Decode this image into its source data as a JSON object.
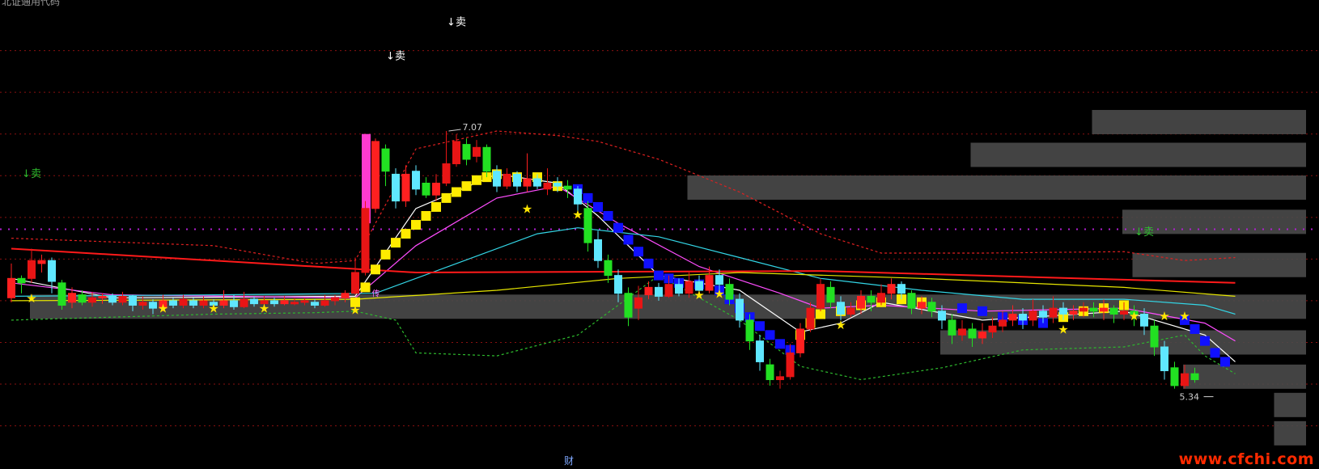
{
  "chart_data": {
    "type": "candlestick",
    "y_range": [
      4.8,
      7.95
    ],
    "grid_levels": [
      7.61,
      7.33,
      7.05,
      6.77,
      6.49,
      6.21,
      5.93,
      5.65,
      5.37,
      5.09
    ],
    "high_price": 7.07,
    "low_price": 5.34,
    "candles": [
      [
        5.95,
        6.08,
        6.18,
        5.92
      ],
      [
        6.08,
        6.05,
        6.1,
        5.98
      ],
      [
        6.08,
        6.2,
        6.28,
        6.05
      ],
      [
        6.18,
        6.2,
        6.24,
        6.12
      ],
      [
        6.2,
        6.06,
        6.22,
        5.98
      ],
      [
        6.05,
        5.9,
        6.07,
        5.87
      ],
      [
        5.92,
        5.98,
        6.02,
        5.88
      ],
      [
        5.97,
        5.92,
        6.0,
        5.9
      ],
      [
        5.92,
        5.95,
        5.99,
        5.89
      ],
      [
        5.95,
        5.96,
        5.98,
        5.91
      ],
      [
        5.96,
        5.92,
        5.98,
        5.9
      ],
      [
        5.92,
        5.96,
        5.99,
        5.9
      ],
      [
        5.96,
        5.9,
        5.97,
        5.86
      ],
      [
        5.9,
        5.92,
        5.96,
        5.87
      ],
      [
        5.92,
        5.88,
        5.94,
        5.84
      ],
      [
        5.88,
        5.93,
        5.97,
        5.86
      ],
      [
        5.93,
        5.9,
        5.95,
        5.88
      ],
      [
        5.9,
        5.94,
        5.97,
        5.88
      ],
      [
        5.93,
        5.9,
        5.95,
        5.88
      ],
      [
        5.9,
        5.93,
        5.96,
        5.88
      ],
      [
        5.92,
        5.9,
        5.94,
        5.87
      ],
      [
        5.9,
        5.93,
        6.0,
        5.88
      ],
      [
        5.93,
        5.89,
        5.97,
        5.87
      ],
      [
        5.89,
        5.94,
        5.99,
        5.88
      ],
      [
        5.94,
        5.91,
        5.96,
        5.89
      ],
      [
        5.91,
        5.93,
        5.96,
        5.9
      ],
      [
        5.93,
        5.91,
        5.95,
        5.89
      ],
      [
        5.91,
        5.93,
        5.96,
        5.9
      ],
      [
        5.92,
        5.92,
        5.95,
        5.9
      ],
      [
        5.92,
        5.93,
        5.95,
        5.9
      ],
      [
        5.92,
        5.9,
        5.94,
        5.88
      ],
      [
        5.9,
        5.93,
        5.97,
        5.89
      ],
      [
        5.93,
        5.95,
        5.97,
        5.9
      ],
      [
        5.95,
        5.98,
        6.0,
        5.92
      ],
      [
        5.98,
        6.12,
        6.22,
        5.97
      ],
      [
        6.12,
        6.55,
        6.6,
        6.1
      ],
      [
        6.55,
        7.0,
        7.02,
        6.52
      ],
      [
        6.95,
        6.8,
        6.98,
        6.7
      ],
      [
        6.78,
        6.6,
        6.82,
        6.55
      ],
      [
        6.6,
        6.78,
        6.84,
        6.56
      ],
      [
        6.8,
        6.68,
        6.84,
        6.64
      ],
      [
        6.72,
        6.64,
        6.76,
        6.62
      ],
      [
        6.64,
        6.72,
        6.78,
        6.6
      ],
      [
        6.72,
        6.85,
        7.07,
        6.7
      ],
      [
        6.85,
        7.0,
        7.05,
        6.83
      ],
      [
        6.98,
        6.88,
        7.02,
        6.84
      ],
      [
        6.9,
        6.96,
        7.01,
        6.86
      ],
      [
        6.96,
        6.8,
        6.98,
        6.76
      ],
      [
        6.8,
        6.7,
        6.84,
        6.66
      ],
      [
        6.7,
        6.78,
        6.82,
        6.68
      ],
      [
        6.78,
        6.7,
        6.8,
        6.66
      ],
      [
        6.7,
        6.75,
        6.92,
        6.66
      ],
      [
        6.75,
        6.7,
        6.78,
        6.68
      ],
      [
        6.68,
        6.72,
        6.82,
        6.64
      ],
      [
        6.72,
        6.7,
        6.76,
        6.66
      ],
      [
        6.7,
        6.68,
        6.74,
        6.62
      ],
      [
        6.68,
        6.58,
        6.7,
        6.5
      ],
      [
        6.55,
        6.32,
        6.6,
        6.26
      ],
      [
        6.34,
        6.2,
        6.4,
        6.15
      ],
      [
        6.2,
        6.1,
        6.24,
        6.05
      ],
      [
        6.1,
        5.98,
        6.14,
        5.92
      ],
      [
        5.98,
        5.82,
        6.02,
        5.76
      ],
      [
        5.88,
        5.95,
        6.03,
        5.8
      ],
      [
        5.97,
        6.02,
        6.06,
        5.94
      ],
      [
        6.02,
        5.96,
        6.05,
        5.93
      ],
      [
        5.96,
        6.04,
        6.1,
        5.95
      ],
      [
        6.04,
        5.98,
        6.08,
        5.96
      ],
      [
        5.98,
        6.06,
        6.12,
        5.95
      ],
      [
        6.06,
        6.0,
        6.1,
        5.96
      ],
      [
        6.0,
        6.1,
        6.16,
        5.98
      ],
      [
        6.1,
        6.04,
        6.14,
        6.0
      ],
      [
        6.04,
        5.94,
        6.08,
        5.9
      ],
      [
        5.94,
        5.8,
        5.98,
        5.75
      ],
      [
        5.8,
        5.66,
        5.84,
        5.6
      ],
      [
        5.66,
        5.52,
        5.7,
        5.46
      ],
      [
        5.5,
        5.4,
        5.54,
        5.36
      ],
      [
        5.4,
        5.42,
        5.46,
        5.34
      ],
      [
        5.42,
        5.58,
        5.64,
        5.4
      ],
      [
        5.58,
        5.74,
        5.78,
        5.55
      ],
      [
        5.74,
        5.88,
        5.92,
        5.72
      ],
      [
        5.88,
        6.04,
        6.08,
        5.86
      ],
      [
        6.02,
        5.92,
        6.06,
        5.88
      ],
      [
        5.92,
        5.84,
        5.96,
        5.8
      ],
      [
        5.84,
        5.88,
        5.92,
        5.82
      ],
      [
        5.88,
        5.96,
        6.0,
        5.84
      ],
      [
        5.96,
        5.92,
        6.0,
        5.86
      ],
      [
        5.92,
        5.98,
        6.04,
        5.9
      ],
      [
        5.98,
        6.04,
        6.08,
        5.94
      ],
      [
        6.04,
        5.98,
        6.06,
        5.94
      ],
      [
        5.98,
        5.88,
        6.0,
        5.84
      ],
      [
        5.88,
        5.92,
        5.96,
        5.84
      ],
      [
        5.92,
        5.86,
        5.95,
        5.82
      ],
      [
        5.86,
        5.8,
        5.9,
        5.74
      ],
      [
        5.8,
        5.7,
        5.84,
        5.64
      ],
      [
        5.7,
        5.74,
        5.8,
        5.66
      ],
      [
        5.74,
        5.68,
        5.78,
        5.62
      ],
      [
        5.68,
        5.72,
        5.78,
        5.64
      ],
      [
        5.72,
        5.76,
        5.82,
        5.68
      ],
      [
        5.76,
        5.8,
        5.86,
        5.72
      ],
      [
        5.8,
        5.84,
        5.9,
        5.76
      ],
      [
        5.84,
        5.8,
        5.88,
        5.74
      ],
      [
        5.8,
        5.86,
        5.94,
        5.76
      ],
      [
        5.86,
        5.82,
        5.9,
        5.78
      ],
      [
        5.82,
        5.88,
        5.96,
        5.78
      ],
      [
        5.88,
        5.84,
        5.92,
        5.8
      ],
      [
        5.84,
        5.86,
        5.9,
        5.8
      ],
      [
        5.86,
        5.88,
        5.92,
        5.82
      ],
      [
        5.88,
        5.86,
        5.92,
        5.82
      ],
      [
        5.86,
        5.88,
        5.94,
        5.8
      ],
      [
        5.88,
        5.84,
        5.9,
        5.78
      ],
      [
        5.84,
        5.86,
        5.92,
        5.8
      ],
      [
        5.86,
        5.84,
        5.9,
        5.76
      ],
      [
        5.84,
        5.76,
        5.88,
        5.7
      ],
      [
        5.76,
        5.62,
        5.8,
        5.56
      ],
      [
        5.62,
        5.46,
        5.66,
        5.4
      ],
      [
        5.48,
        5.36,
        5.52,
        5.34
      ],
      [
        5.36,
        5.44,
        5.5,
        5.34
      ],
      [
        5.44,
        5.4,
        5.48,
        5.38
      ]
    ],
    "ma_lines": [
      {
        "name": "white",
        "color": "#ffffff",
        "points": [
          [
            0,
            6.08
          ],
          [
            10,
            5.95
          ],
          [
            34,
            5.96
          ],
          [
            40,
            6.55
          ],
          [
            48,
            6.78
          ],
          [
            54,
            6.72
          ],
          [
            58,
            6.5
          ],
          [
            64,
            6.1
          ],
          [
            72,
            6.0
          ],
          [
            78,
            5.72
          ],
          [
            82,
            5.78
          ],
          [
            86,
            5.92
          ],
          [
            96,
            5.8
          ],
          [
            110,
            5.86
          ],
          [
            118,
            5.7
          ],
          [
            121,
            5.52
          ]
        ]
      },
      {
        "name": "magenta",
        "color": "#ff4dff",
        "points": [
          [
            0,
            6.05
          ],
          [
            10,
            5.97
          ],
          [
            34,
            5.95
          ],
          [
            40,
            6.3
          ],
          [
            48,
            6.62
          ],
          [
            54,
            6.7
          ],
          [
            60,
            6.45
          ],
          [
            68,
            6.16
          ],
          [
            76,
            5.98
          ],
          [
            80,
            5.88
          ],
          [
            86,
            5.9
          ],
          [
            96,
            5.86
          ],
          [
            110,
            5.88
          ],
          [
            118,
            5.78
          ],
          [
            121,
            5.66
          ]
        ]
      },
      {
        "name": "cyan",
        "color": "#33d6e6",
        "points": [
          [
            0,
            5.96
          ],
          [
            20,
            5.97
          ],
          [
            36,
            5.98
          ],
          [
            44,
            6.18
          ],
          [
            52,
            6.38
          ],
          [
            56,
            6.42
          ],
          [
            64,
            6.36
          ],
          [
            72,
            6.22
          ],
          [
            80,
            6.08
          ],
          [
            90,
            6.0
          ],
          [
            100,
            5.94
          ],
          [
            110,
            5.94
          ],
          [
            118,
            5.9
          ],
          [
            121,
            5.84
          ]
        ]
      },
      {
        "name": "yellow",
        "color": "#e6e600",
        "points": [
          [
            0,
            5.93
          ],
          [
            34,
            5.94
          ],
          [
            48,
            6.0
          ],
          [
            60,
            6.08
          ],
          [
            72,
            6.12
          ],
          [
            90,
            6.08
          ],
          [
            110,
            6.02
          ],
          [
            121,
            5.96
          ]
        ]
      },
      {
        "name": "red",
        "color": "#ff1a1a",
        "points": [
          [
            0,
            6.28
          ],
          [
            40,
            6.12
          ],
          [
            80,
            6.13
          ],
          [
            121,
            6.05
          ]
        ]
      },
      {
        "name": "upper-band",
        "color": "#e02020",
        "points": [
          [
            0,
            6.35
          ],
          [
            20,
            6.3
          ],
          [
            30,
            6.18
          ],
          [
            34,
            6.2
          ],
          [
            40,
            6.95
          ],
          [
            48,
            7.07
          ],
          [
            54,
            7.04
          ],
          [
            58,
            7.0
          ],
          [
            64,
            6.88
          ],
          [
            72,
            6.66
          ],
          [
            80,
            6.38
          ],
          [
            86,
            6.25
          ],
          [
            96,
            6.25
          ],
          [
            110,
            6.26
          ],
          [
            116,
            6.2
          ],
          [
            121,
            6.22
          ]
        ]
      },
      {
        "name": "lower-band",
        "color": "#2db92d",
        "points": [
          [
            0,
            5.8
          ],
          [
            20,
            5.84
          ],
          [
            30,
            5.85
          ],
          [
            34,
            5.86
          ],
          [
            38,
            5.8
          ],
          [
            40,
            5.58
          ],
          [
            48,
            5.56
          ],
          [
            56,
            5.7
          ],
          [
            64,
            6.1
          ],
          [
            72,
            5.8
          ],
          [
            78,
            5.49
          ],
          [
            84,
            5.4
          ],
          [
            92,
            5.48
          ],
          [
            100,
            5.6
          ],
          [
            110,
            5.62
          ],
          [
            116,
            5.7
          ],
          [
            118,
            5.56
          ],
          [
            121,
            5.44
          ]
        ]
      }
    ],
    "purple_level": 6.41,
    "staircase": {
      "support": [
        [
          34,
          5.92
        ],
        [
          35,
          6.02
        ],
        [
          36,
          6.14
        ],
        [
          37,
          6.24
        ],
        [
          38,
          6.32
        ],
        [
          39,
          6.38
        ],
        [
          40,
          6.44
        ],
        [
          41,
          6.5
        ],
        [
          42,
          6.56
        ],
        [
          43,
          6.62
        ],
        [
          44,
          6.66
        ],
        [
          45,
          6.7
        ],
        [
          46,
          6.74
        ],
        [
          47,
          6.76
        ],
        [
          48,
          6.78
        ],
        [
          50,
          6.76
        ],
        [
          52,
          6.76
        ],
        [
          54,
          6.7
        ],
        [
          78,
          5.7
        ],
        [
          79,
          5.78
        ],
        [
          80,
          5.84
        ],
        [
          82,
          5.86
        ],
        [
          84,
          5.9
        ],
        [
          86,
          5.92
        ],
        [
          88,
          5.94
        ],
        [
          90,
          5.92
        ],
        [
          104,
          5.82
        ],
        [
          106,
          5.86
        ],
        [
          108,
          5.88
        ],
        [
          110,
          5.9
        ]
      ],
      "resistance": [
        [
          56,
          6.68
        ],
        [
          57,
          6.62
        ],
        [
          58,
          6.56
        ],
        [
          59,
          6.5
        ],
        [
          60,
          6.42
        ],
        [
          61,
          6.34
        ],
        [
          62,
          6.26
        ],
        [
          63,
          6.18
        ],
        [
          64,
          6.1
        ],
        [
          65,
          6.08
        ],
        [
          66,
          6.05
        ],
        [
          68,
          6.04
        ],
        [
          70,
          6.0
        ],
        [
          71,
          5.94
        ],
        [
          72,
          5.88
        ],
        [
          73,
          5.82
        ],
        [
          74,
          5.76
        ],
        [
          75,
          5.7
        ],
        [
          76,
          5.64
        ],
        [
          77,
          5.6
        ],
        [
          94,
          5.88
        ],
        [
          96,
          5.86
        ],
        [
          98,
          5.82
        ],
        [
          100,
          5.8
        ],
        [
          102,
          5.78
        ],
        [
          116,
          5.8
        ],
        [
          117,
          5.74
        ],
        [
          118,
          5.66
        ],
        [
          119,
          5.58
        ],
        [
          120,
          5.52
        ]
      ]
    },
    "stars": [
      [
        2,
        5.92
      ],
      [
        15,
        5.85
      ],
      [
        20,
        5.85
      ],
      [
        25,
        5.85
      ],
      [
        34,
        5.84
      ],
      [
        51,
        6.52
      ],
      [
        56,
        6.48
      ],
      [
        68,
        5.94
      ],
      [
        70,
        5.95
      ],
      [
        82,
        5.74
      ],
      [
        104,
        5.71
      ],
      [
        111,
        5.8
      ],
      [
        114,
        5.8
      ],
      [
        116,
        5.8
      ]
    ],
    "volume_profile": [
      {
        "price": 7.13,
        "start": 107
      },
      {
        "price": 6.91,
        "start": 95
      },
      {
        "price": 6.69,
        "start": 67
      },
      {
        "price": 6.46,
        "start": 110
      },
      {
        "price": 6.17,
        "start": 111
      },
      {
        "price": 5.89,
        "start": 2
      },
      {
        "price": 5.65,
        "start": 92
      },
      {
        "price": 5.42,
        "start": 116
      },
      {
        "price": 5.23,
        "start": 125
      },
      {
        "price": 5.04,
        "start": 125
      }
    ],
    "signals": [
      {
        "text": "↓卖",
        "x": 44,
        "y": 7.78,
        "color": "#ffffff"
      },
      {
        "text": "↓卖",
        "x": 38,
        "y": 7.55,
        "color": "#ffffff"
      },
      {
        "text": "↓卖",
        "x": 2,
        "y": 6.76,
        "color": "#2db92d"
      },
      {
        "text": "↓卖",
        "x": 112,
        "y": 6.37,
        "color": "#2db92d"
      }
    ],
    "label_high": "7.07",
    "label_low": "5.34",
    "label_small": "传"
  },
  "watermark": "www.cfchi.com",
  "bottom_mark": "财",
  "top_left_text": "北证通用代码"
}
